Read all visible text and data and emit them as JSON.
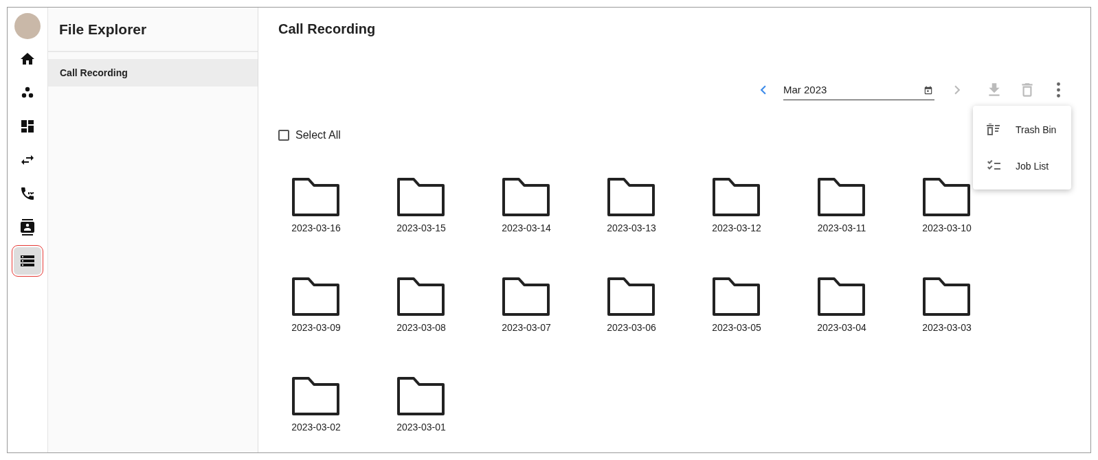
{
  "rail": {
    "items": [
      {
        "selected": false
      },
      {
        "selected": false
      },
      {
        "selected": false
      },
      {
        "selected": false
      },
      {
        "selected": false
      },
      {
        "selected": false
      },
      {
        "selected": true
      }
    ]
  },
  "sidebar": {
    "title": "File Explorer",
    "items": [
      {
        "label": "Call Recording",
        "selected": true
      }
    ]
  },
  "main": {
    "title": "Call Recording",
    "toolbar": {
      "prev": {
        "disabled": false
      },
      "month": {
        "value": "Mar 2023"
      },
      "next": {
        "disabled": true
      },
      "download": {
        "disabled": true
      },
      "delete": {
        "disabled": true
      }
    },
    "menu": {
      "items": [
        {
          "label": "Trash Bin"
        },
        {
          "label": "Job List"
        }
      ]
    },
    "select_all": {
      "label": "Select All",
      "checked": false
    },
    "folders": [
      {
        "name": "2023-03-16"
      },
      {
        "name": "2023-03-15"
      },
      {
        "name": "2023-03-14"
      },
      {
        "name": "2023-03-13"
      },
      {
        "name": "2023-03-12"
      },
      {
        "name": "2023-03-11"
      },
      {
        "name": "2023-03-10"
      },
      {
        "name": "2023-03-09"
      },
      {
        "name": "2023-03-08"
      },
      {
        "name": "2023-03-07"
      },
      {
        "name": "2023-03-06"
      },
      {
        "name": "2023-03-05"
      },
      {
        "name": "2023-03-04"
      },
      {
        "name": "2023-03-03"
      },
      {
        "name": "2023-03-02"
      },
      {
        "name": "2023-03-01"
      }
    ]
  }
}
